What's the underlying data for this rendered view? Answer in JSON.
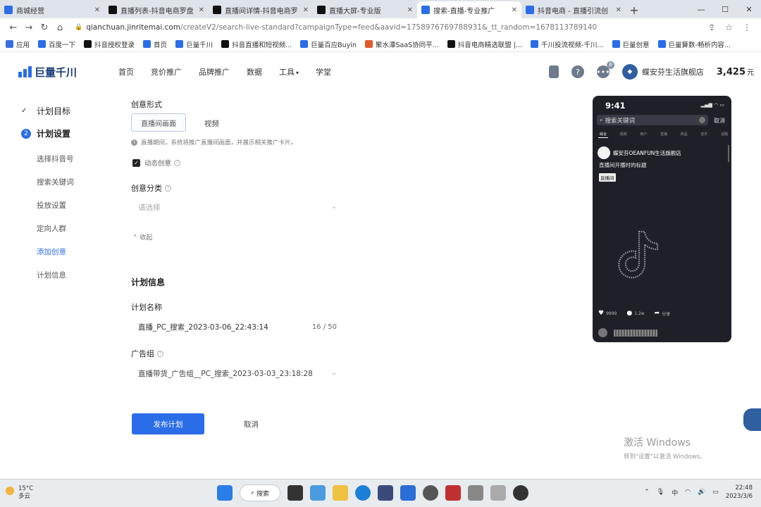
{
  "browser": {
    "tabs": [
      {
        "label": "商城经营",
        "icon_color": "#2b6de8",
        "active": false
      },
      {
        "label": "直播列表-抖音电商罗盘",
        "icon_color": "#111111",
        "active": false
      },
      {
        "label": "直播间详情-抖音电商罗",
        "icon_color": "#111111",
        "active": false
      },
      {
        "label": "直播大屏-专业版",
        "icon_color": "#111111",
        "active": false
      },
      {
        "label": "搜索-直播-专业推广",
        "icon_color": "#2b6de8",
        "active": true
      },
      {
        "label": "抖音电商 - 直播引流创",
        "icon_color": "#2b6de8",
        "active": false
      }
    ],
    "url_host": "qianchuan.jinritemai.com",
    "url_path": "/createV2/search-live-standard?campaignType=feed&aavid=1758976769788931&_tt_random=1678113789140",
    "bookmarks": [
      "应用",
      "百度一下",
      "抖音授权登录",
      "首页",
      "巨量千川",
      "抖音直播和短视频...",
      "巨量百应Buyin",
      "聚水潭SaaS协同平...",
      "抖音电商精选联盟 |...",
      "千川投流视频-千川...",
      "巨量创意",
      "巨量算数-畅析内容..."
    ]
  },
  "header": {
    "logo_text": "巨量千川",
    "nav": [
      "首页",
      "竞价推广",
      "品牌推广",
      "数据",
      "工具",
      "学堂"
    ],
    "tools_arrow": "▾",
    "notification_count": "8",
    "shop_name": "蝶安芬生活旗舰店",
    "balance": "3,425",
    "balance_unit": "元"
  },
  "sidebar": {
    "step1": {
      "label": "计划目标",
      "mark": "✓"
    },
    "step2": {
      "label": "计划设置",
      "num": "2"
    },
    "items": [
      "选择抖音号",
      "搜索关键词",
      "投放设置",
      "定向人群",
      "添加创意",
      "计划信息"
    ],
    "active_index": 4
  },
  "form": {
    "creative_form_label": "创意形式",
    "opt_live": "直播间画面",
    "opt_video": "视频",
    "hint": "直播期间，系统将推广直播间画面，并展示相关推广卡片。",
    "dynamic_creative": "动态创意",
    "category_label": "创意分类",
    "category_placeholder": "请选择",
    "collapse": "收起",
    "plan_info_title": "计划信息",
    "plan_name_label": "计划名称",
    "plan_name_value": "直播_PC_搜索_2023-03-06_22:43:14",
    "plan_name_count": "16 / 50",
    "ad_group_label": "广告组",
    "ad_group_value": "直播带货_广告组__PC_搜索_2023-03-03_23:18:28",
    "publish": "发布计划",
    "cancel": "取消"
  },
  "phone": {
    "time": "9:41",
    "search_placeholder": "搜索关键词",
    "cancel": "取消",
    "tabs": [
      "综合",
      "视频",
      "用户",
      "直播",
      "商品",
      "音乐",
      "话题"
    ],
    "shop": "蝶安芬OEANFUN生活旗舰店",
    "desc": "直播间开播时的标题",
    "tag": "直播间",
    "likes": "9999",
    "comments": "1.2w",
    "share": "分享"
  },
  "watermark": {
    "line1": "激活 Windows",
    "line2": "转到\"设置\"以激活 Windows。"
  },
  "taskbar": {
    "temp": "15°C",
    "weather": "多云",
    "search": "搜索",
    "ime": "中",
    "time": "22:48",
    "date": "2023/3/6"
  }
}
